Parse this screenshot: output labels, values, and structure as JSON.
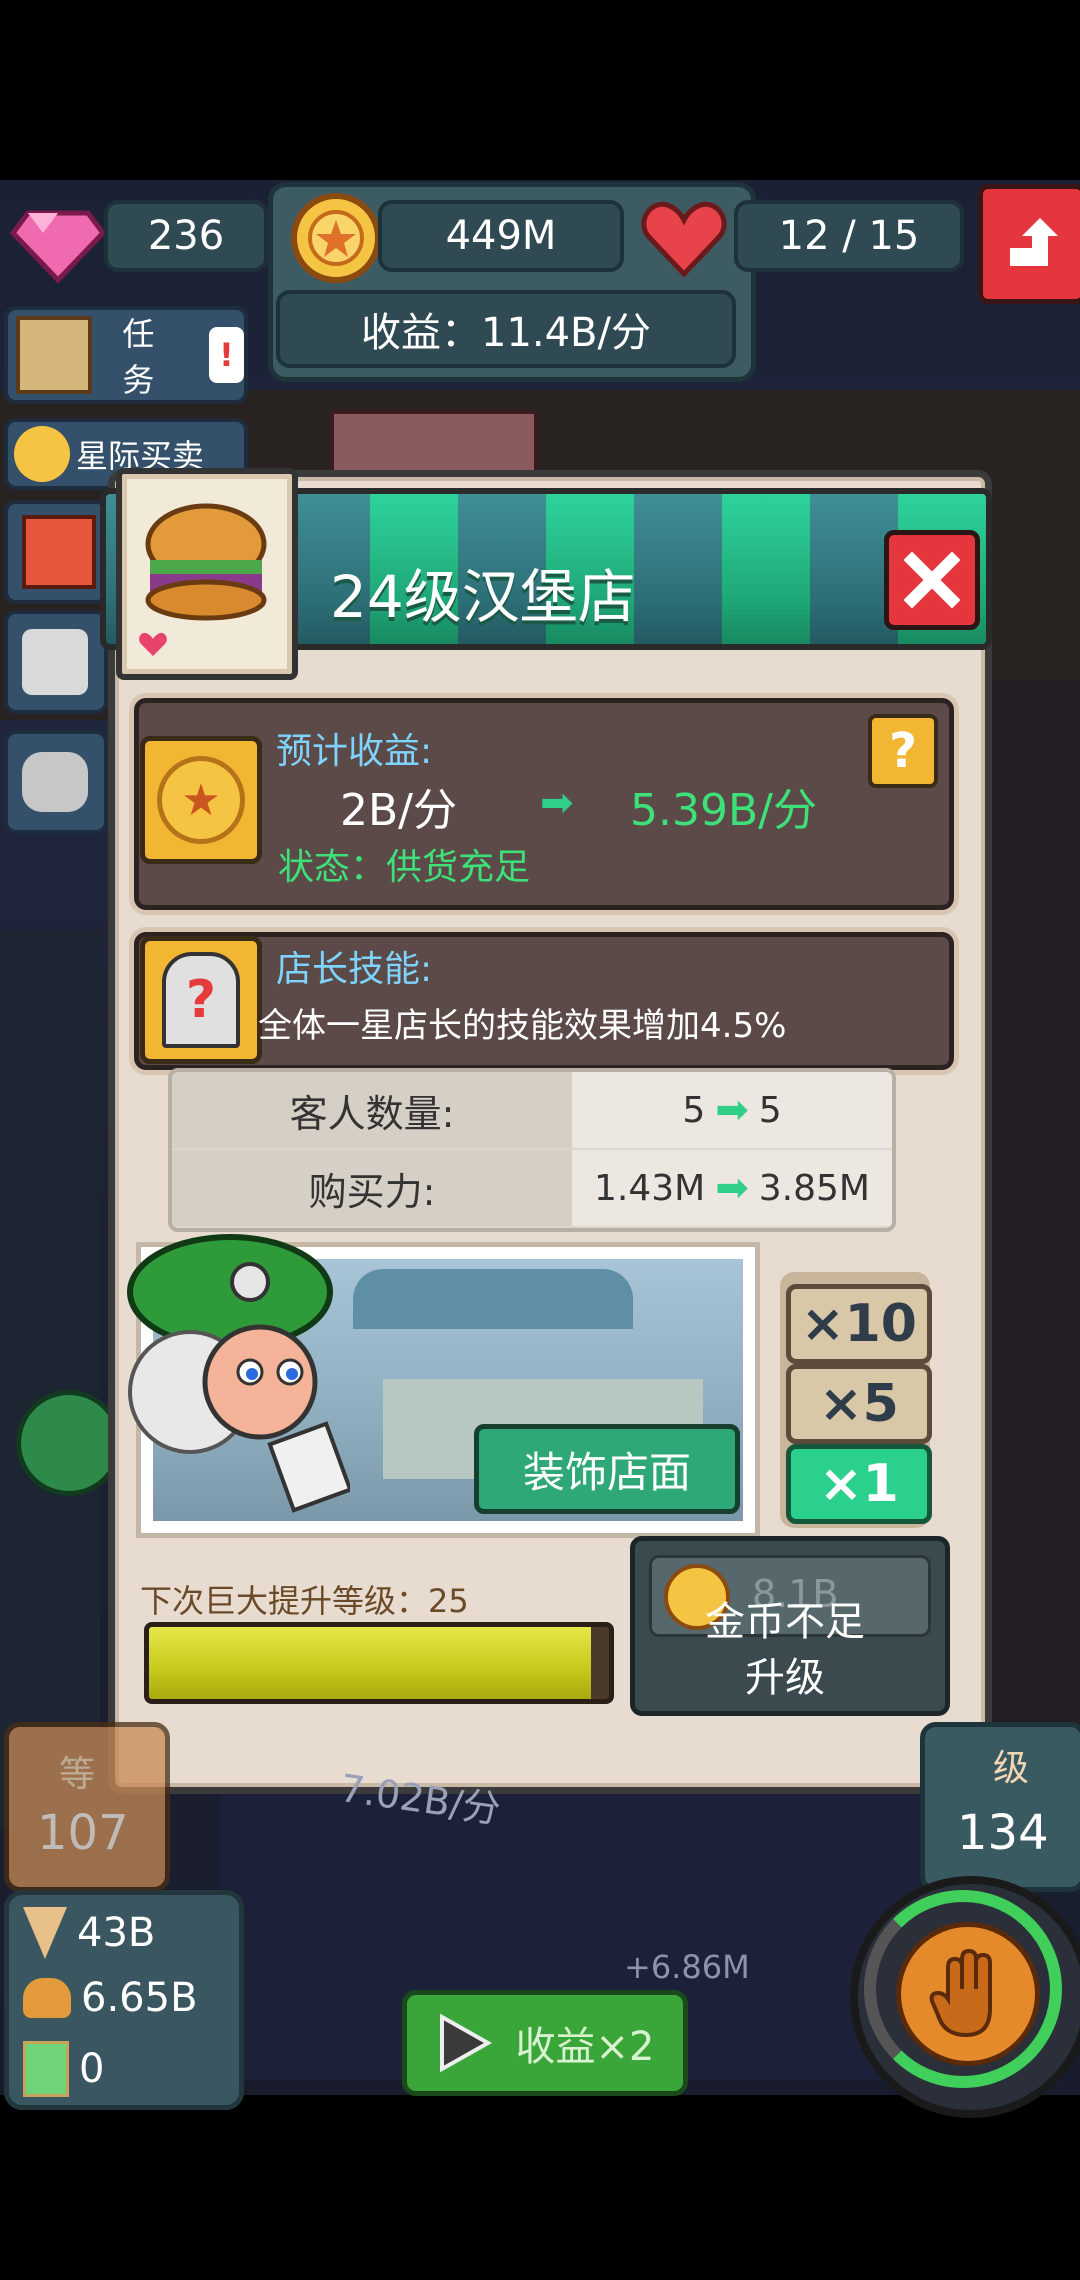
{
  "top_bar": {
    "gems": "236",
    "coins": "449M",
    "hearts": "12 / 15",
    "income": "收益：11.4B/分"
  },
  "left_menu": {
    "task_label": "任务",
    "trade_label": "星际买卖"
  },
  "modal": {
    "title": "24级汉堡店",
    "income_label": "预计收益:",
    "income_current": "2B/分",
    "income_next": "5.39B/分",
    "status": "状态：供货充足",
    "skill_label": "店长技能:",
    "skill_desc": "全体一星店长的技能效果增加4.5%",
    "stats": [
      {
        "label": "客人数量:",
        "current": "5",
        "next": "5"
      },
      {
        "label": "购买力:",
        "current": "1.43M",
        "next": "3.85M"
      }
    ],
    "decorate_label": "装饰店面",
    "multipliers": [
      "×10",
      "×5",
      "×1"
    ],
    "active_multiplier": "×1",
    "next_big_upgrade": "下次巨大提升等级：25",
    "progress_fraction": 0.96,
    "upgrade_cost_partial": "8.1B",
    "upgrade_status": "金币不足",
    "upgrade_label": "升级"
  },
  "bottom": {
    "left_level_label": "等",
    "left_level": "107",
    "right_level_label": "级",
    "right_level": "134",
    "resources": [
      {
        "icon": "ice-cream-icon",
        "value": "43B"
      },
      {
        "icon": "burger-icon",
        "value": "6.65B"
      },
      {
        "icon": "drink-icon",
        "value": "0"
      }
    ],
    "income_bg": "7.02B/分",
    "floating_gain": "+6.86M",
    "boost_label": "收益×2"
  },
  "colors": {
    "accent_green": "#2fcf87",
    "income_next": "#3ee07a",
    "close_red": "#e5363d",
    "coin_gold": "#f2b632"
  }
}
